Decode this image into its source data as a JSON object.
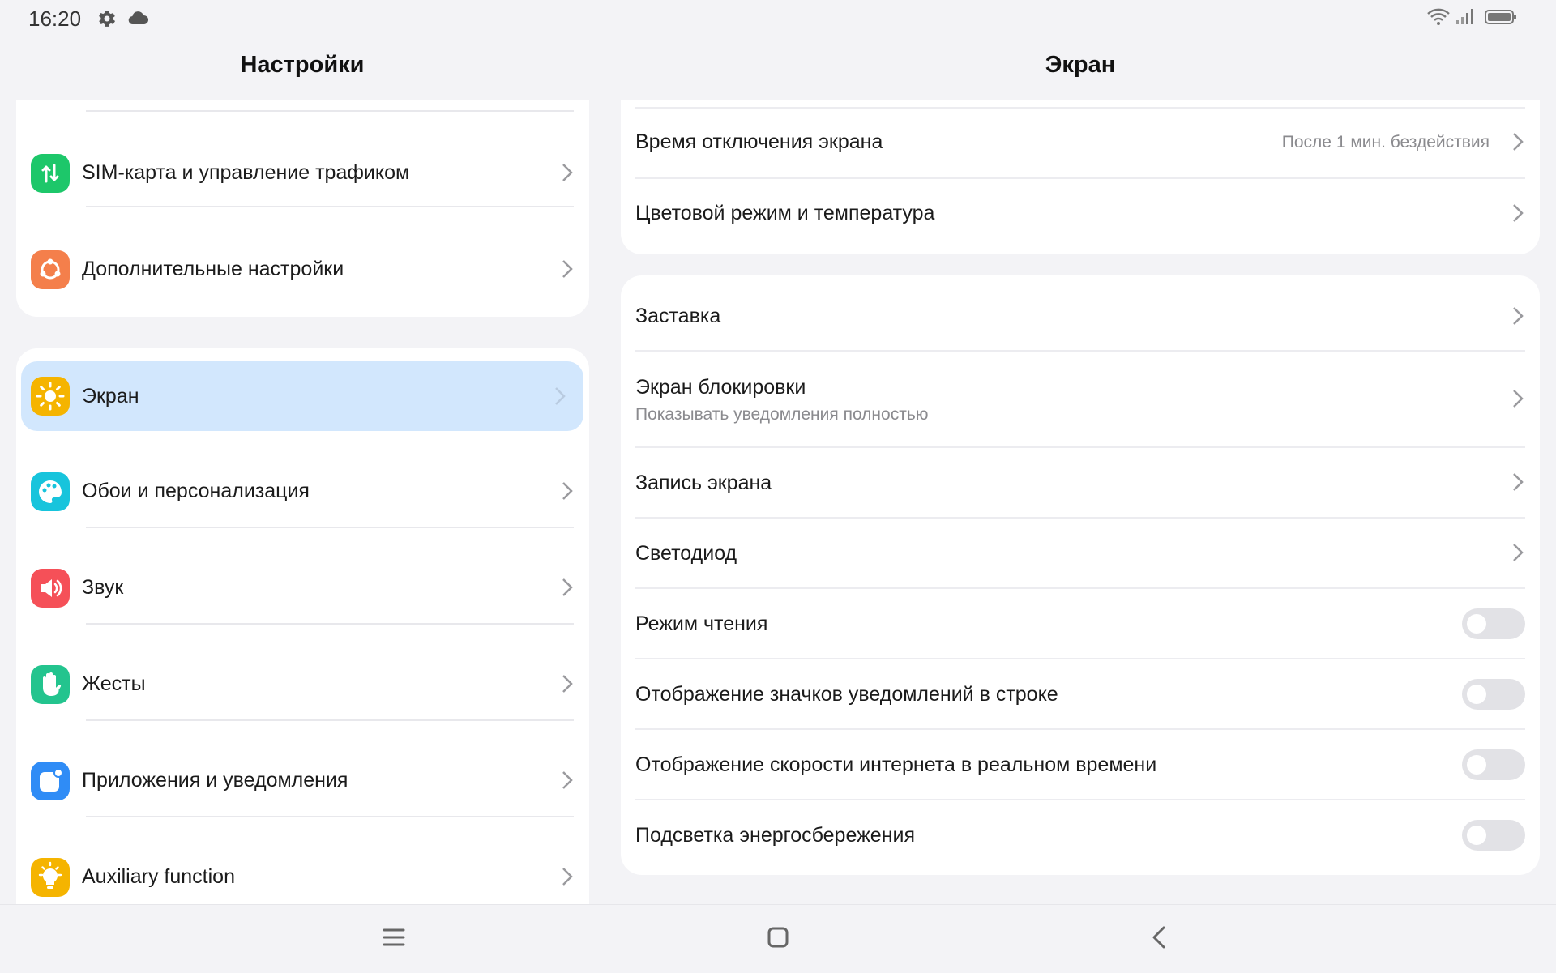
{
  "status_bar": {
    "time": "16:20",
    "icons": [
      "gear-icon",
      "cloud-icon",
      "wifi-icon",
      "signal-icon",
      "battery-icon"
    ]
  },
  "left_panel": {
    "title": "Настройки",
    "group1": [
      {
        "label": "SIM-карта и управление трафиком",
        "icon": "sim-traffic-icon",
        "color": "#1dc76a"
      },
      {
        "label": "Дополнительные настройки",
        "icon": "more-settings-icon",
        "color": "#f47f4b"
      }
    ],
    "group2": [
      {
        "label": "Экран",
        "icon": "sun-icon",
        "color": "#f5b400",
        "selected": true
      },
      {
        "label": "Обои и персонализация",
        "icon": "palette-icon",
        "color": "#17c4dc"
      },
      {
        "label": "Звук",
        "icon": "speaker-icon",
        "color": "#f55058"
      },
      {
        "label": "Жесты",
        "icon": "hand-icon",
        "color": "#23c48e"
      },
      {
        "label": "Приложения и уведомления",
        "icon": "apps-icon",
        "color": "#2f8cf6"
      },
      {
        "label": "Auxiliary function",
        "icon": "bulb-icon",
        "color": "#f5b400"
      }
    ]
  },
  "right_panel": {
    "title": "Экран",
    "group1": [
      {
        "label": "Время отключения экрана",
        "value": "После 1 мин. бездействия"
      },
      {
        "label": "Цветовой режим и температура"
      }
    ],
    "group2": [
      {
        "label": "Заставка",
        "type": "link"
      },
      {
        "label": "Экран блокировки",
        "sub": "Показывать уведомления полностью",
        "type": "link"
      },
      {
        "label": "Запись экрана",
        "type": "link"
      },
      {
        "label": "Светодиод",
        "type": "link"
      },
      {
        "label": "Режим чтения",
        "type": "toggle",
        "on": false
      },
      {
        "label": "Отображение значков уведомлений в строке",
        "type": "toggle",
        "on": false
      },
      {
        "label": "Отображение скорости интернета в реальном времени",
        "type": "toggle",
        "on": false
      },
      {
        "label": "Подсветка энергосбережения",
        "type": "toggle",
        "on": false
      }
    ]
  },
  "nav_bar": {
    "buttons": [
      "menu-icon",
      "home-icon",
      "back-icon"
    ]
  }
}
